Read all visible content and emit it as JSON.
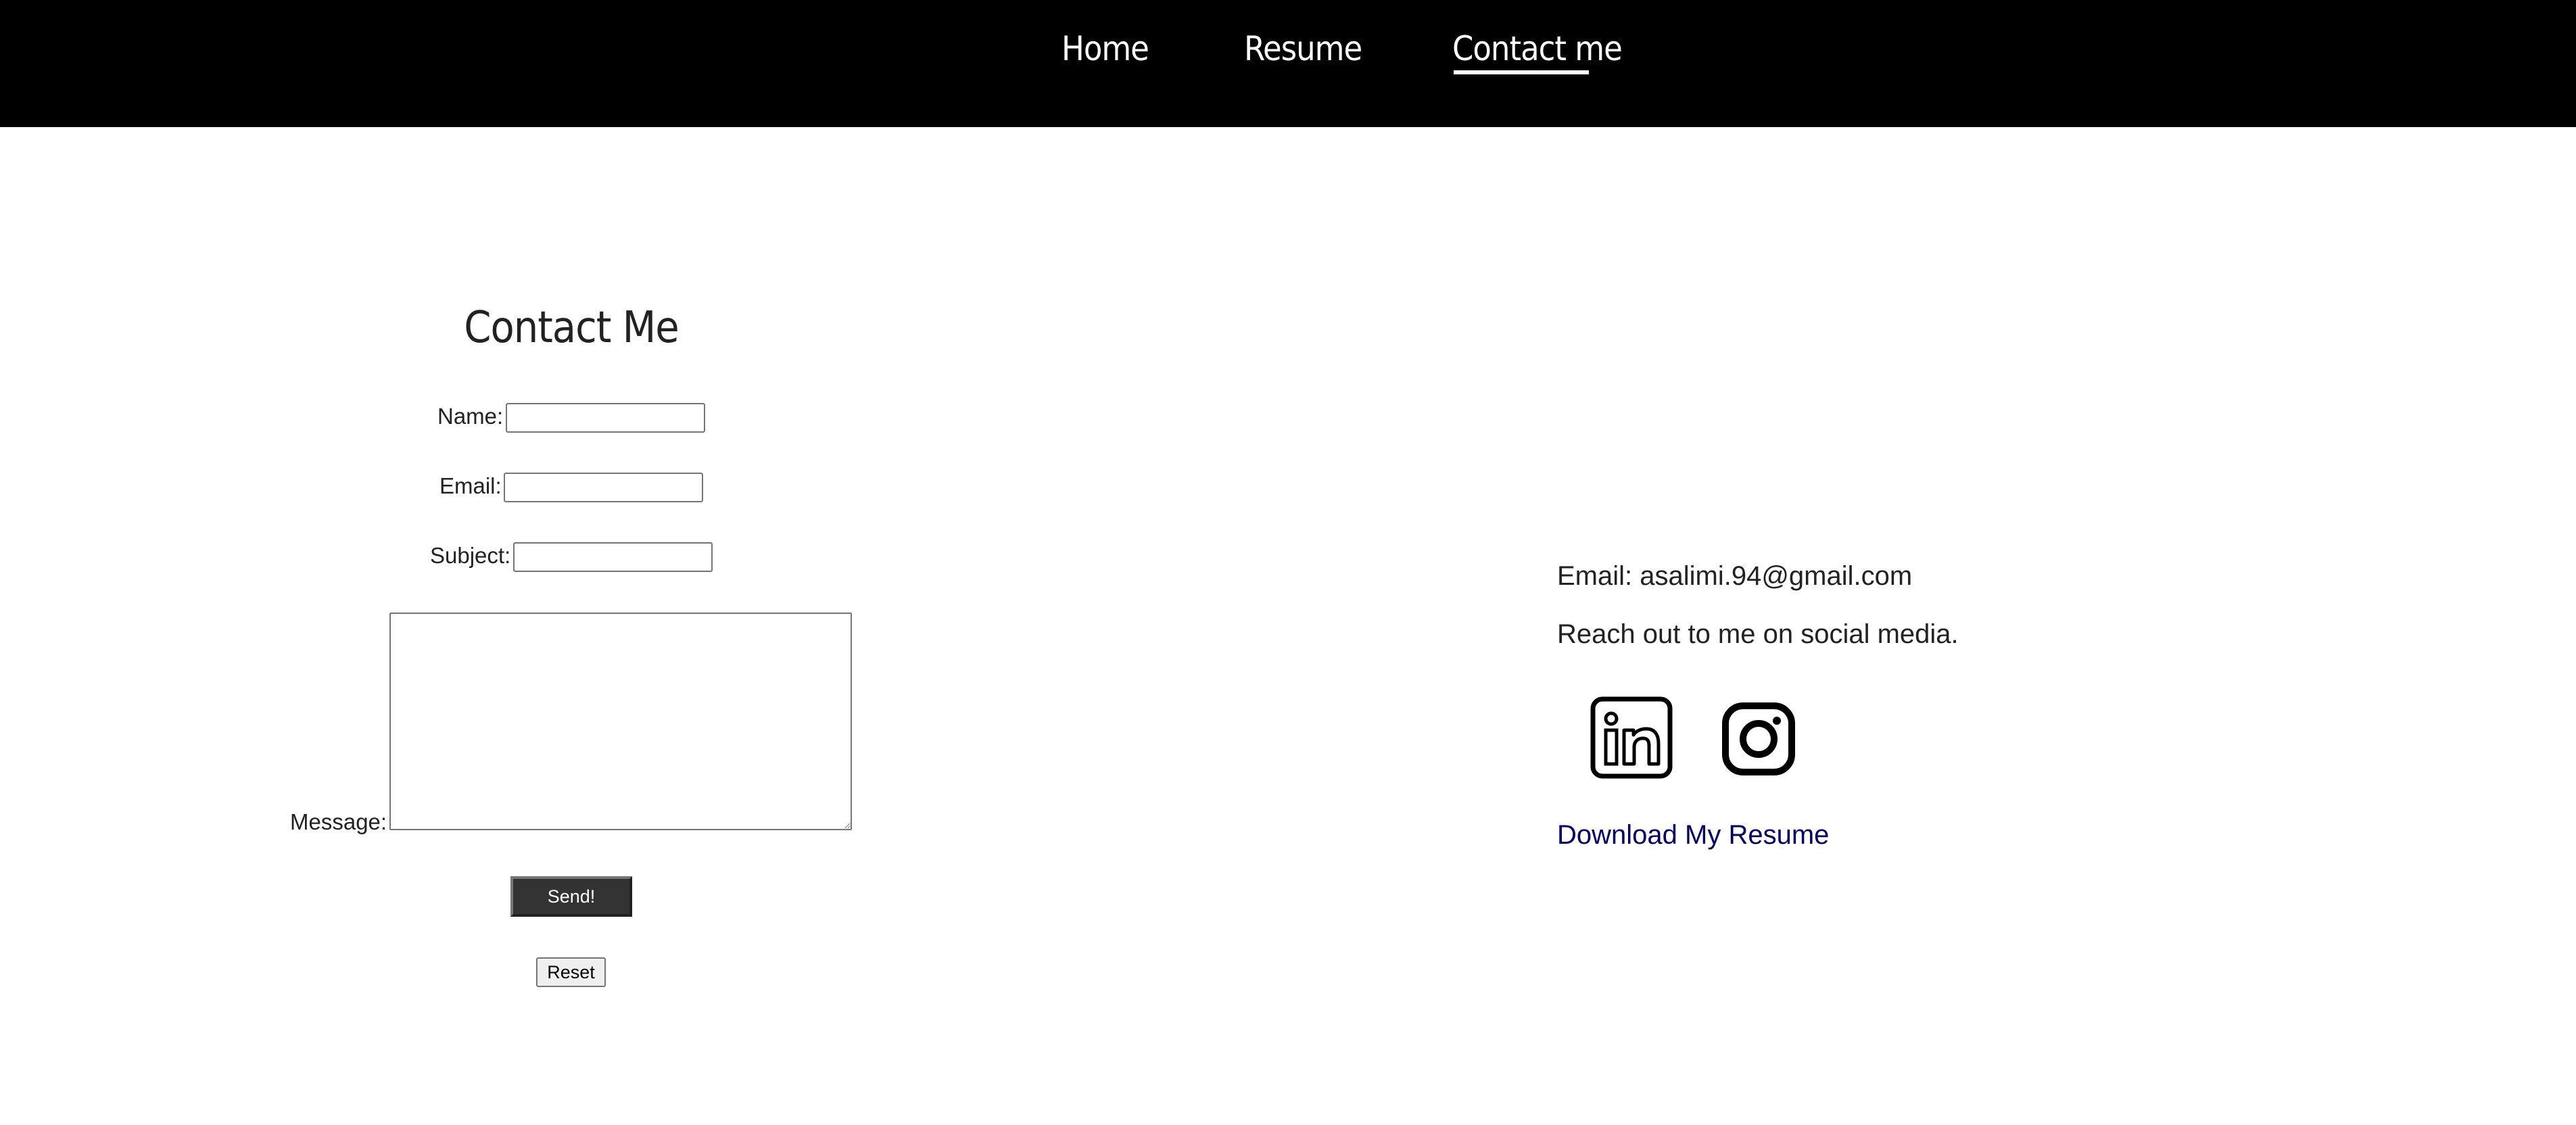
{
  "nav": {
    "items": [
      {
        "label": "Home",
        "active": false
      },
      {
        "label": "Resume",
        "active": false
      },
      {
        "label": "Contact me",
        "active": true
      }
    ]
  },
  "form": {
    "title": "Contact Me",
    "name_label": "Name:",
    "name_value": "",
    "email_label": "Email:",
    "email_value": "",
    "subject_label": "Subject:",
    "subject_value": "",
    "message_label": "Message:",
    "message_value": "",
    "send_label": "Send!",
    "reset_label": "Reset"
  },
  "info": {
    "email_text": "Email: asalimi.94@gmail.com",
    "social_text": "Reach out to me on social media.",
    "download_label": "Download My Resume",
    "social_icons": [
      "linkedin-icon",
      "instagram-icon"
    ]
  },
  "colors": {
    "nav_background": "#000000",
    "nav_text": "#ffffff",
    "send_button_bg": "#333333",
    "download_link": "#000066"
  }
}
